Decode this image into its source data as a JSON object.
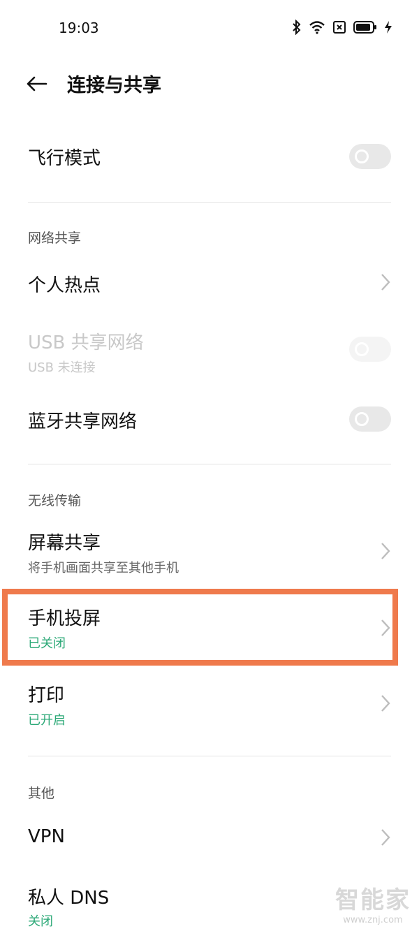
{
  "status_bar": {
    "time": "19:03",
    "icons": [
      "bluetooth-icon",
      "wifi-icon",
      "sim-icon",
      "battery-icon",
      "charging-icon"
    ]
  },
  "header": {
    "title": "连接与共享"
  },
  "airplane": {
    "label": "飞行模式",
    "enabled": false
  },
  "network_sharing": {
    "section_label": "网络共享",
    "hotspot_label": "个人热点",
    "usb_label": "USB 共享网络",
    "usb_sub": "USB 未连接",
    "bt_label": "蓝牙共享网络"
  },
  "wireless": {
    "section_label": "无线传输",
    "screen_share_label": "屏幕共享",
    "screen_share_sub": "将手机画面共享至其他手机",
    "cast_label": "手机投屏",
    "cast_status": "已关闭",
    "print_label": "打印",
    "print_status": "已开启"
  },
  "other": {
    "section_label": "其他",
    "vpn_label": "VPN",
    "dns_label": "私人 DNS",
    "dns_status": "关闭"
  },
  "colors": {
    "status_green": "#2aa876",
    "highlight": "#ef7a4c",
    "toggle_off": "#e8e8e8"
  },
  "watermark": {
    "brand": "智能家",
    "site": "www.znj.com"
  }
}
